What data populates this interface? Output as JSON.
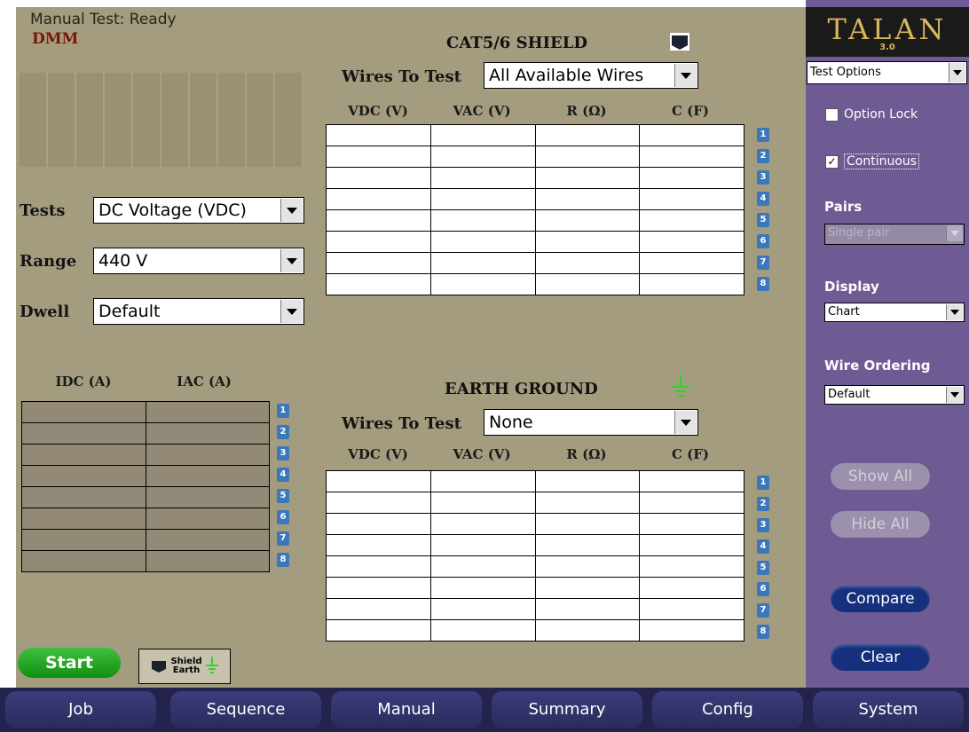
{
  "header": {
    "status": "Manual Test: Ready",
    "mode": "DMM"
  },
  "controls": {
    "tests_label": "Tests",
    "tests_value": "DC Voltage (VDC)",
    "range_label": "Range",
    "range_value": "440 V",
    "dwell_label": "Dwell",
    "dwell_value": "Default"
  },
  "current_table": {
    "col1": "IDC (A)",
    "col2": "IAC (A)",
    "rows": [
      "1",
      "2",
      "3",
      "4",
      "5",
      "6",
      "7",
      "8"
    ]
  },
  "shield": {
    "title": "CAT5/6 SHIELD",
    "wires_label": "Wires To Test",
    "wires_value": "All Available Wires",
    "columns": [
      "VDC (V)",
      "VAC (V)",
      "R (Ω)",
      "C (F)"
    ],
    "rows": [
      "1",
      "2",
      "3",
      "4",
      "5",
      "6",
      "7",
      "8"
    ]
  },
  "earth": {
    "title": "EARTH GROUND",
    "wires_label": "Wires To Test",
    "wires_value": "None",
    "columns": [
      "VDC (V)",
      "VAC (V)",
      "R (Ω)",
      "C (F)"
    ],
    "rows": [
      "1",
      "2",
      "3",
      "4",
      "5",
      "6",
      "7",
      "8"
    ]
  },
  "buttons": {
    "start": "Start",
    "shield_earth_1": "Shield",
    "shield_earth_2": "Earth"
  },
  "sidebar": {
    "logo": "TALAN",
    "version": "3.0",
    "test_options": "Test Options",
    "option_lock": "Option Lock",
    "option_lock_checked": false,
    "continuous": "Continuous",
    "continuous_checked": true,
    "pairs_label": "Pairs",
    "pairs_value": "Single pair",
    "display_label": "Display",
    "display_value": "Chart",
    "wire_ordering_label": "Wire Ordering",
    "wire_ordering_value": "Default",
    "show_all": "Show All",
    "hide_all": "Hide All",
    "compare": "Compare",
    "clear": "Clear"
  },
  "nav": [
    "Job",
    "Sequence",
    "Manual",
    "Summary",
    "Config",
    "System"
  ],
  "colors": {
    "panel": "#a49c7e",
    "sidebar": "#6e5b93",
    "nav": "#23234e",
    "accent_green": "#22a022",
    "accent_blue": "#16307e"
  }
}
